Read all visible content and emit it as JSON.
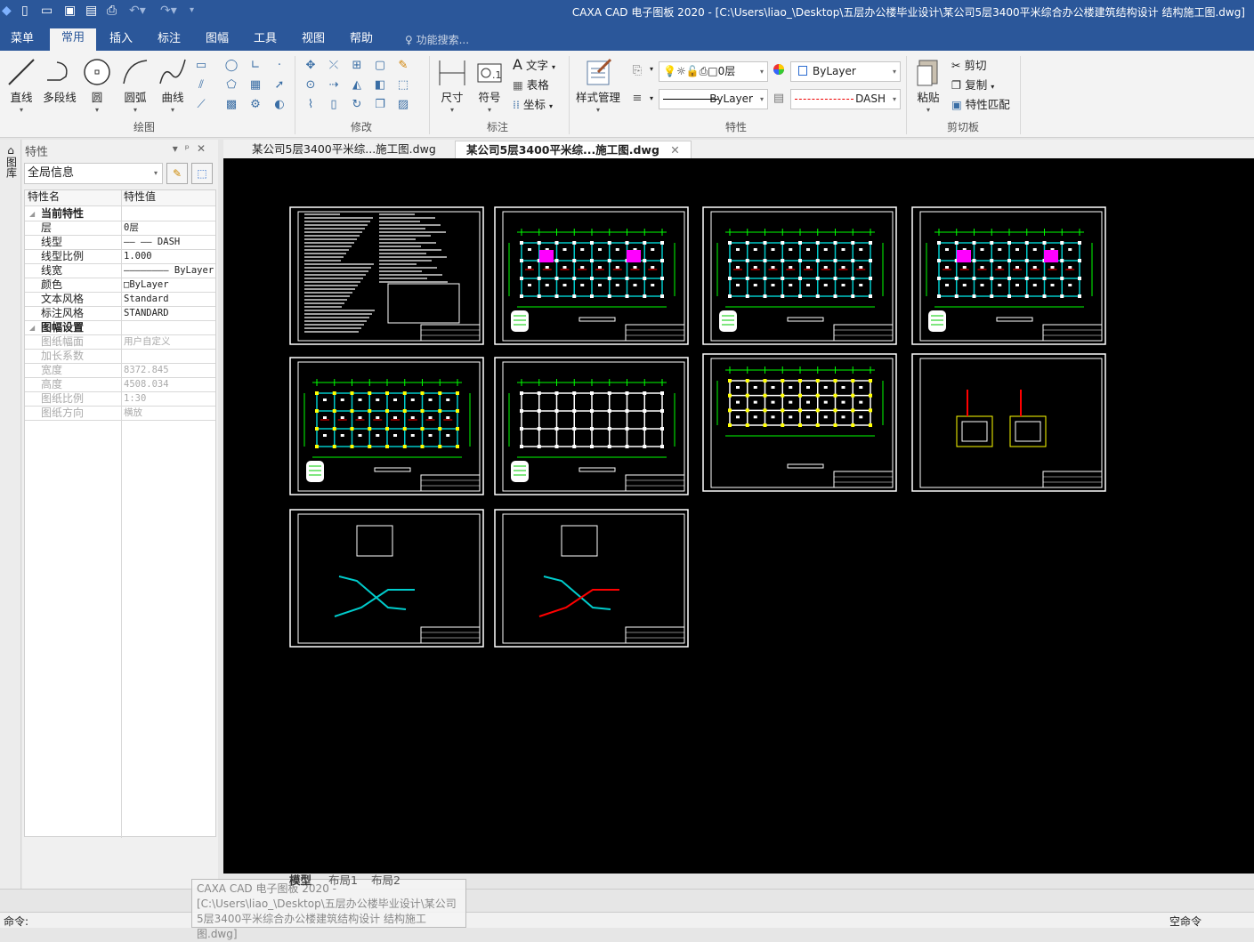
{
  "titlebar": {
    "title": "CAXA CAD 电子图板 2020 - [C:\\Users\\liao_\\Desktop\\五层办公楼毕业设计\\某公司5层3400平米综合办公楼建筑结构设计 结构施工图.dwg]"
  },
  "ribbon_tabs": [
    {
      "label": "菜单"
    },
    {
      "label": "常用"
    },
    {
      "label": "插入"
    },
    {
      "label": "标注"
    },
    {
      "label": "图幅"
    },
    {
      "label": "工具"
    },
    {
      "label": "视图"
    },
    {
      "label": "帮助"
    }
  ],
  "search_placeholder": "功能搜索...",
  "draw_group": {
    "label": "绘图",
    "buttons": [
      "直线",
      "多段线",
      "圆",
      "圆弧",
      "曲线"
    ]
  },
  "modify_group": {
    "label": "修改"
  },
  "annot_group": {
    "label": "标注",
    "buttons": [
      "尺寸",
      "符号"
    ],
    "small": [
      "文字",
      "表格",
      "坐标"
    ]
  },
  "props_group": {
    "label": "特性",
    "style_button": "样式管理",
    "layer": "0层",
    "color": "ByLayer",
    "linewidth": "ByLayer",
    "linetype": "DASH"
  },
  "clip_group": {
    "label": "剪切板",
    "paste": "粘贴",
    "cut": "剪切",
    "copy": "复制",
    "match": "特性匹配"
  },
  "panel": {
    "title": "特性",
    "side_label": "图库",
    "selector": "全局信息",
    "col_name": "特性名",
    "col_value": "特性值",
    "sections": [
      {
        "title": "当前特性",
        "rows": [
          {
            "k": "层",
            "v": "0层"
          },
          {
            "k": "线型",
            "v": "——  —— DASH"
          },
          {
            "k": "线型比例",
            "v": "1.000"
          },
          {
            "k": "线宽",
            "v": "———————— ByLayer"
          },
          {
            "k": "颜色",
            "v": "□ByLayer"
          },
          {
            "k": "文本风格",
            "v": "Standard"
          },
          {
            "k": "标注风格",
            "v": "STANDARD"
          }
        ]
      },
      {
        "title": "图幅设置",
        "rows": [
          {
            "k": "图纸幅面",
            "v": "用户自定义"
          },
          {
            "k": "加长系数",
            "v": ""
          },
          {
            "k": "宽度",
            "v": "8372.845"
          },
          {
            "k": "高度",
            "v": "4508.034"
          },
          {
            "k": "图纸比例",
            "v": "1:30"
          },
          {
            "k": "图纸方向",
            "v": "横放"
          }
        ]
      }
    ]
  },
  "doc_tabs": [
    {
      "label": "某公司5层3400平米综...施工图.dwg"
    },
    {
      "label": "某公司5层3400平米综...施工图.dwg",
      "active": true
    }
  ],
  "model_tabs": [
    "模型",
    "布局1",
    "布局2"
  ],
  "tooltip": "CAXA CAD 电子图板 2020 - [C:\\Users\\liao_\\Desktop\\五层办公楼毕业设计\\某公司5层3400平米综合办公楼建筑结构设计 结构施工图.dwg]",
  "status": {
    "command_label": "命令:",
    "right": "空命令"
  },
  "colors": {
    "titlebar": "#2b579a",
    "canvas": "#000000",
    "cad_green": "#00ff00",
    "cad_cyan": "#00c0c0",
    "cad_magenta": "#ff00ff"
  }
}
